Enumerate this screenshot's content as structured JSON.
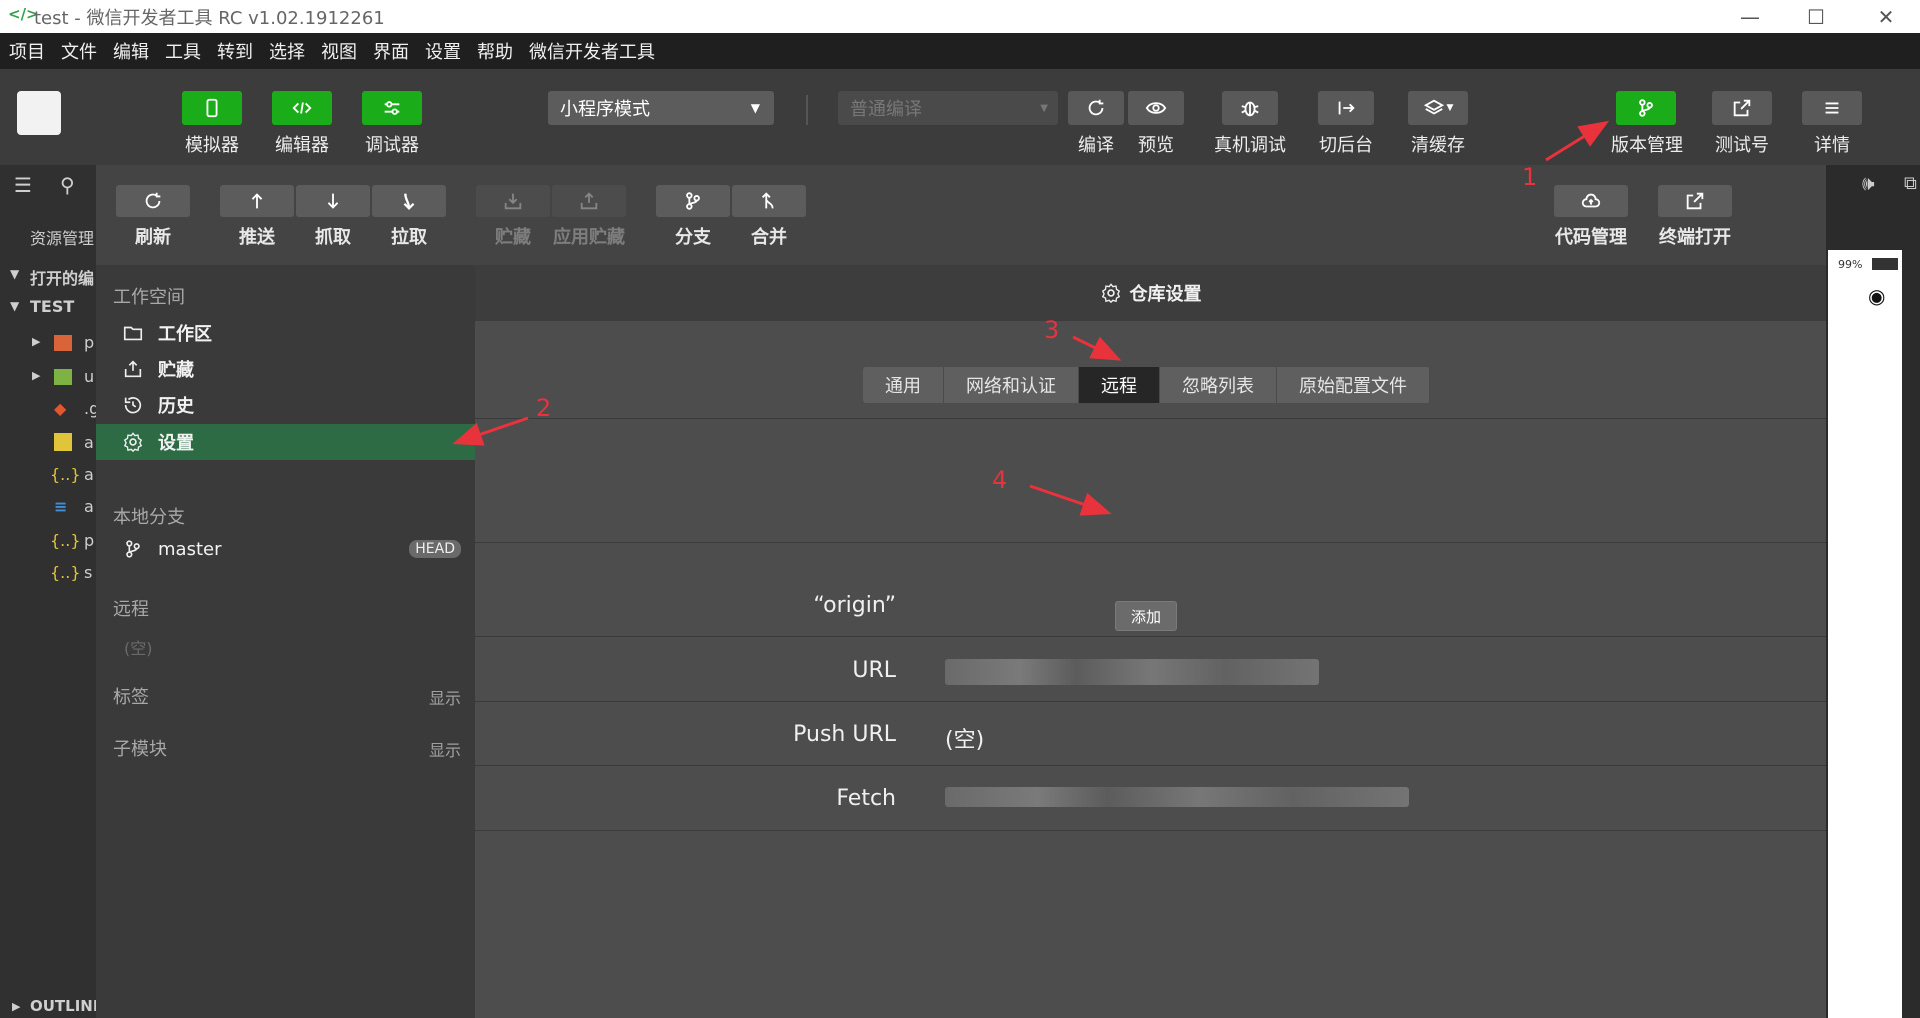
{
  "window": {
    "title": "test - 微信开发者工具 RC v1.02.1912261"
  },
  "menu": [
    "项目",
    "文件",
    "编辑",
    "工具",
    "转到",
    "选择",
    "视图",
    "界面",
    "设置",
    "帮助",
    "微信开发者工具"
  ],
  "toolbar": {
    "simulator": "模拟器",
    "editor": "编辑器",
    "debugger": "调试器",
    "mode": "小程序模式",
    "compile_mode": "普通编译",
    "compile": "编译",
    "preview": "预览",
    "real_debug": "真机调试",
    "background": "切后台",
    "clear_cache": "清缓存",
    "version_control": "版本管理",
    "test_account": "测试号",
    "details": "详情"
  },
  "ide_left": {
    "resource_manager": "资源管理",
    "open_editors": "打开的编",
    "project": "TEST",
    "outline": "OUTLINE",
    "file_letters": [
      "p",
      "u",
      ".g",
      "a",
      "a",
      "a",
      "p",
      "s"
    ]
  },
  "simulator": {
    "battery": "99%"
  },
  "vc_toolbar": {
    "refresh": "刷新",
    "push": "推送",
    "fetch": "抓取",
    "pull": "拉取",
    "stash": "贮藏",
    "apply_stash": "应用贮藏",
    "branch": "分支",
    "merge": "合并",
    "code_manage": "代码管理",
    "open_terminal": "终端打开"
  },
  "sidebar": {
    "workspace_title": "工作空间",
    "items": [
      {
        "label": "工作区",
        "icon": "folder-icon"
      },
      {
        "label": "贮藏",
        "icon": "stash-icon"
      },
      {
        "label": "历史",
        "icon": "history-icon"
      },
      {
        "label": "设置",
        "icon": "gear-icon"
      }
    ],
    "local_branch_title": "本地分支",
    "branch": "master",
    "head_badge": "HEAD",
    "remote_title": "远程",
    "remote_empty": "(空)",
    "tags_title": "标签",
    "tags_show": "显示",
    "submodule_title": "子模块",
    "submodule_show": "显示"
  },
  "settings": {
    "header": "仓库设置",
    "tabs": [
      "通用",
      "网络和认证",
      "远程",
      "忽略列表",
      "原始配置文件"
    ],
    "active_tab": "远程",
    "add_button": "添加",
    "remote_name": "“origin”",
    "fields": [
      {
        "label": "URL",
        "value": ""
      },
      {
        "label": "Push URL",
        "value": "(空)"
      },
      {
        "label": "Fetch",
        "value": ""
      }
    ]
  },
  "annotations": [
    "1",
    "2",
    "3",
    "4"
  ],
  "colors": {
    "green": "#1aad19",
    "annotation": "#e8323c",
    "active_item": "#2d6b45"
  }
}
